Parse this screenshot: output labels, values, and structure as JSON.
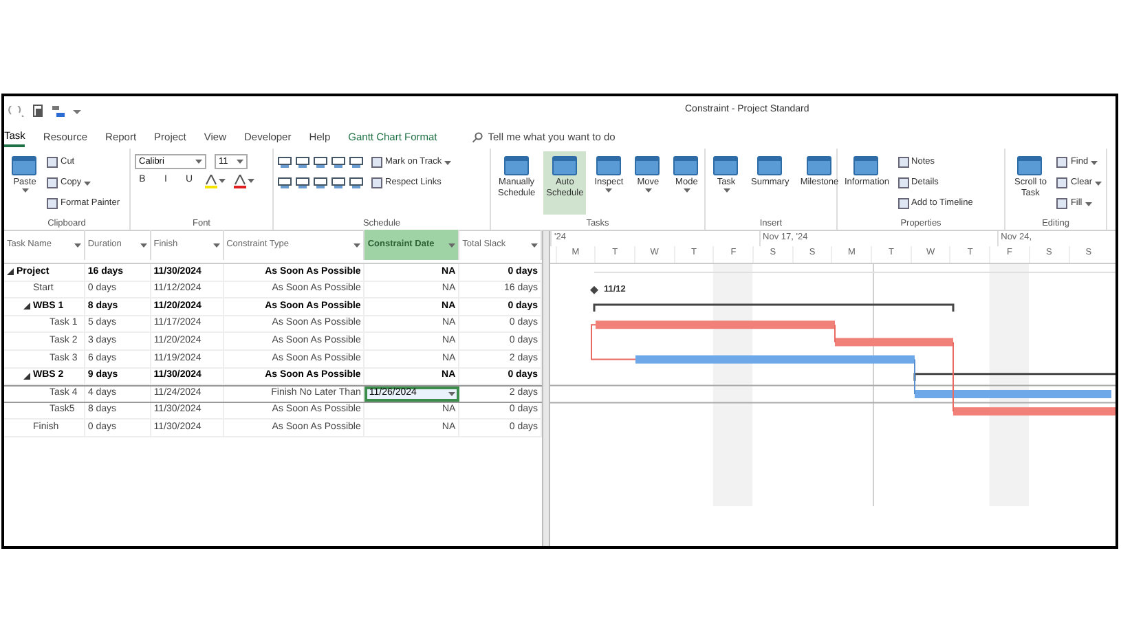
{
  "window": {
    "title": "Constraint - Project Standard"
  },
  "tabs": [
    {
      "label": "Task",
      "selected": true,
      "kind": "normal"
    },
    {
      "label": "Resource",
      "selected": false,
      "kind": "normal"
    },
    {
      "label": "Report",
      "selected": false,
      "kind": "normal"
    },
    {
      "label": "Project",
      "selected": false,
      "kind": "normal"
    },
    {
      "label": "View",
      "selected": false,
      "kind": "normal"
    },
    {
      "label": "Developer",
      "selected": false,
      "kind": "normal"
    },
    {
      "label": "Help",
      "selected": false,
      "kind": "normal"
    },
    {
      "label": "Gantt Chart Format",
      "selected": false,
      "kind": "contextual"
    }
  ],
  "tell_me": {
    "placeholder": "Tell me what you want to do"
  },
  "ribbon": [
    {
      "label": "Clipboard",
      "items": [
        {
          "kind": "large",
          "label": "Paste",
          "has_menu": true,
          "selected": false
        },
        {
          "kind": "stack",
          "items": [
            {
              "kind": "small",
              "label": "Cut"
            },
            {
              "kind": "small",
              "label": "Copy",
              "has_menu": true
            },
            {
              "kind": "small",
              "label": "Format Painter"
            }
          ]
        }
      ]
    },
    {
      "label": "Font",
      "items": [
        {
          "kind": "stack",
          "items": [
            {
              "kind": "row",
              "items": [
                {
                  "kind": "field",
                  "value": "Calibri"
                },
                {
                  "kind": "field",
                  "value": "11"
                }
              ]
            },
            {
              "kind": "row",
              "items": [
                {
                  "kind": "char",
                  "label": "B"
                },
                {
                  "kind": "char",
                  "label": "I"
                },
                {
                  "kind": "char",
                  "label": "U"
                },
                {
                  "kind": "tool",
                  "color": "#f5e400"
                },
                {
                  "kind": "tool",
                  "color": "#e02020"
                }
              ]
            }
          ]
        }
      ]
    },
    {
      "label": "Schedule",
      "items": [
        {
          "kind": "stack",
          "items": [
            {
              "kind": "row",
              "items": [
                {
                  "kind": "strip"
                },
                {
                  "kind": "small",
                  "label": "Mark on Track",
                  "has_menu": true
                }
              ]
            },
            {
              "kind": "row",
              "items": [
                {
                  "kind": "strip"
                },
                {
                  "kind": "small",
                  "label": "Respect Links"
                }
              ]
            }
          ]
        }
      ]
    },
    {
      "label": "Tasks",
      "items": [
        {
          "kind": "large",
          "label": "Manually Schedule",
          "has_menu": false,
          "selected": false
        },
        {
          "kind": "large",
          "label": "Auto Schedule",
          "has_menu": false,
          "selected": true
        },
        {
          "kind": "large",
          "label": "Inspect",
          "has_menu": true,
          "selected": false
        },
        {
          "kind": "large",
          "label": "Move",
          "has_menu": true,
          "selected": false
        },
        {
          "kind": "large",
          "label": "Mode",
          "has_menu": true,
          "selected": false
        }
      ]
    },
    {
      "label": "Insert",
      "items": [
        {
          "kind": "large",
          "label": "Task",
          "has_menu": true,
          "selected": false
        },
        {
          "kind": "large",
          "label": "Summary",
          "has_menu": false,
          "selected": false
        },
        {
          "kind": "large",
          "label": "Milestone",
          "has_menu": false,
          "selected": false
        }
      ]
    },
    {
      "label": "Properties",
      "items": [
        {
          "kind": "large",
          "label": "Information",
          "has_menu": false,
          "selected": false
        },
        {
          "kind": "stack",
          "items": [
            {
              "kind": "small",
              "label": "Notes"
            },
            {
              "kind": "small",
              "label": "Details"
            },
            {
              "kind": "small",
              "label": "Add to Timeline"
            }
          ]
        }
      ]
    },
    {
      "label": "Editing",
      "items": [
        {
          "kind": "large",
          "label": "Scroll to Task",
          "has_menu": false,
          "selected": false
        },
        {
          "kind": "stack",
          "items": [
            {
              "kind": "small",
              "label": "Find",
              "has_menu": true
            },
            {
              "kind": "small",
              "label": "Clear",
              "has_menu": true
            },
            {
              "kind": "small",
              "label": "Fill",
              "has_menu": true
            }
          ]
        }
      ]
    }
  ],
  "table": {
    "columns": [
      {
        "label": "Task Name",
        "selected": false
      },
      {
        "label": "Duration",
        "selected": false
      },
      {
        "label": "Finish",
        "selected": false
      },
      {
        "label": "Constraint Type",
        "selected": false
      },
      {
        "label": "Constraint Date",
        "selected": true
      },
      {
        "label": "Total Slack",
        "selected": false
      }
    ],
    "rows": [
      {
        "name": "Project",
        "duration": "16 days",
        "finish": "11/30/2024",
        "constraint_type": "As Soon As Possible",
        "constraint_date": "NA",
        "total_slack": "0 days",
        "kind": "summary",
        "expanded": true,
        "selected": false,
        "children": [
          {
            "name": "Start",
            "duration": "0 days",
            "finish": "11/12/2024",
            "constraint_type": "As Soon As Possible",
            "constraint_date": "NA",
            "total_slack": "16 days",
            "kind": "task",
            "selected": false
          },
          {
            "name": "WBS 1",
            "duration": "8 days",
            "finish": "11/20/2024",
            "constraint_type": "As Soon As Possible",
            "constraint_date": "NA",
            "total_slack": "0 days",
            "kind": "summary",
            "expanded": true,
            "selected": false,
            "children": [
              {
                "name": "Task 1",
                "duration": "5 days",
                "finish": "11/17/2024",
                "constraint_type": "As Soon As Possible",
                "constraint_date": "NA",
                "total_slack": "0 days",
                "kind": "task",
                "selected": false
              },
              {
                "name": "Task 2",
                "duration": "3 days",
                "finish": "11/20/2024",
                "constraint_type": "As Soon As Possible",
                "constraint_date": "NA",
                "total_slack": "0 days",
                "kind": "task",
                "selected": false
              },
              {
                "name": "Task 3",
                "duration": "6 days",
                "finish": "11/19/2024",
                "constraint_type": "As Soon As Possible",
                "constraint_date": "NA",
                "total_slack": "2 days",
                "kind": "task",
                "selected": false
              }
            ]
          },
          {
            "name": "WBS 2",
            "duration": "9 days",
            "finish": "11/30/2024",
            "constraint_type": "As Soon As Possible",
            "constraint_date": "NA",
            "total_slack": "0 days",
            "kind": "summary",
            "expanded": true,
            "selected": false,
            "children": [
              {
                "name": "Task 4",
                "duration": "4 days",
                "finish": "11/24/2024",
                "constraint_type": "Finish No Later Than",
                "constraint_date": "11/26/2024",
                "total_slack": "2 days",
                "kind": "task",
                "selected": true
              },
              {
                "name": "Task5",
                "duration": "8 days",
                "finish": "11/30/2024",
                "constraint_type": "As Soon As Possible",
                "constraint_date": "NA",
                "total_slack": "0 days",
                "kind": "task",
                "selected": false
              }
            ]
          },
          {
            "name": "Finish",
            "duration": "0 days",
            "finish": "11/30/2024",
            "constraint_type": "As Soon As Possible",
            "constraint_date": "NA",
            "total_slack": "0 days",
            "kind": "task",
            "selected": false
          }
        ]
      }
    ]
  },
  "gantt": {
    "weeks": [
      "'24",
      "Nov 17, '24",
      "Nov 24,"
    ],
    "days": [
      "M",
      "T",
      "W",
      "T",
      "F",
      "S",
      "S",
      "M",
      "T",
      "W",
      "T",
      "F",
      "S",
      "S"
    ],
    "milestone_label": "11/12"
  }
}
